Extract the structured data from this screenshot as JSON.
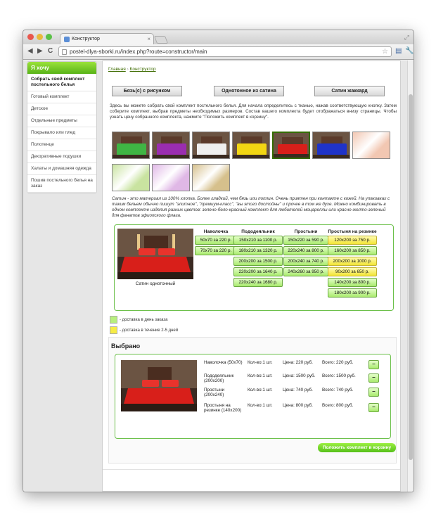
{
  "browser": {
    "tab_title": "Конструктор",
    "tab_close": "×",
    "back": "◀",
    "forward": "▶",
    "reload": "C",
    "url": "postel-dlya-sborki.ru/index.php?route=constructor/main",
    "star": "☆",
    "wrench": "🔧",
    "resize": "⤢"
  },
  "sidebar": {
    "title": "Я хочу",
    "items": [
      "Собрать свой комплект постельного белья",
      "Готовый комплект",
      "Детское",
      "Отдельные предметы",
      "Покрывало или плед",
      "Полотенце",
      "Декоративные подушки",
      "Халаты и домашняя одежда",
      "Пошив постельного белья на заказ"
    ]
  },
  "breadcrumb": {
    "home": "Главная",
    "sep": "›",
    "current": "Конструктор"
  },
  "type_buttons": [
    "Бязь(c) с рисунком",
    "Однотонное из сатина",
    "Сатин жаккард"
  ],
  "intro": "Здесь вы можете собрать свой комплект постельного белья. Для начала определитесь с тканью, нажав соответствующую кнопку. Затем соберите комплект, выбрав предметы необходимых размеров. Состав вашего комплекта будет отображаться внизу страницы. Чтобы узнать цену собранного комплекта, нажмите \"Положить комплект в корзину\".",
  "colors": {
    "swatches": [
      "#3fb544",
      "#9a2db0",
      "#eeeeee",
      "#f2d613",
      "#d81f1a",
      "#1f33c8",
      "#f2c7b2",
      "#c9e3a0",
      "#e0b8e6",
      "#d6c08c"
    ],
    "selected_index": 4,
    "accent": "#6cc04a"
  },
  "fabric_description": "Сатин - это материал из 100% хлопка. Более гладкий, чем бязь или поплин. Очень приятен при контакте с кожей. На упаковках с таким бельем обычно пишут \"элитное\", \"премиум-класс\", \"вы этого достойны\" и прочее в том же духе. Можно комбинировать в одном комплекте изделия разных цветов: зелено-бело-красный комплект для любителей моцареллы или красно-желто-зеленый для фанатов эфиопского флага.",
  "builder": {
    "caption": "Сатин однотонный",
    "columns": [
      {
        "title": "Наволочка",
        "options": [
          {
            "label": "50x70 за 220 р.",
            "fast": true
          },
          {
            "label": "70x70 за 220 р.",
            "fast": true
          }
        ]
      },
      {
        "title": "Пододеяльник",
        "options": [
          {
            "label": "150x210 за 1100 р.",
            "fast": true
          },
          {
            "label": "180x210 за 1320 р.",
            "fast": true
          },
          {
            "label": "200x200 за 1500 р.",
            "fast": true
          },
          {
            "label": "220x200 за 1640 р.",
            "fast": true
          },
          {
            "label": "220x240 за 1680 р.",
            "fast": true
          }
        ]
      },
      {
        "title": "Простыни",
        "options": [
          {
            "label": "150x220 за 590 р.",
            "fast": true
          },
          {
            "label": "220x240 за 800 р.",
            "fast": true
          },
          {
            "label": "200x240 за 740 р.",
            "fast": true
          },
          {
            "label": "240x260 за 950 р.",
            "fast": true
          }
        ]
      },
      {
        "title": "Простыня на резинке",
        "options": [
          {
            "label": "120x200 за 750 р.",
            "fast": false
          },
          {
            "label": "160x200 за 850 р.",
            "fast": true
          },
          {
            "label": "200x200 за 1000 р.",
            "fast": false
          },
          {
            "label": "90x200 за 650 р.",
            "fast": false
          },
          {
            "label": "140x200 за 800 р.",
            "fast": true
          },
          {
            "label": "180x200 за 900 р.",
            "fast": true
          }
        ]
      }
    ]
  },
  "legend": {
    "fast": "- доставка в день заказа",
    "slow": "- доставка в течение 2-5 дней",
    "fast_color": "#b8ef7e",
    "slow_color": "#f6ec45"
  },
  "selected": {
    "title": "Выбрано",
    "minus": "–",
    "rows": [
      {
        "name": "Наволочка (50x70)",
        "qty": "Кол-во:1 шт.",
        "price": "Цена: 220 руб.",
        "total": "Всего: 220 руб."
      },
      {
        "name": "Пододеяльник (200x200)",
        "qty": "Кол-во:1 шт.",
        "price": "Цена: 1500 руб.",
        "total": "Всего: 1500 руб."
      },
      {
        "name": "Простыни (200x240)",
        "qty": "Кол-во:1 шт.",
        "price": "Цена: 740 руб.",
        "total": "Всего: 740 руб."
      },
      {
        "name": "Простыня на резинке (140x200)",
        "qty": "Кол-во:1 шт.",
        "price": "Цена: 800 руб.",
        "total": "Всего: 800 руб."
      }
    ],
    "add_button": "Положить комплект в корзину"
  }
}
